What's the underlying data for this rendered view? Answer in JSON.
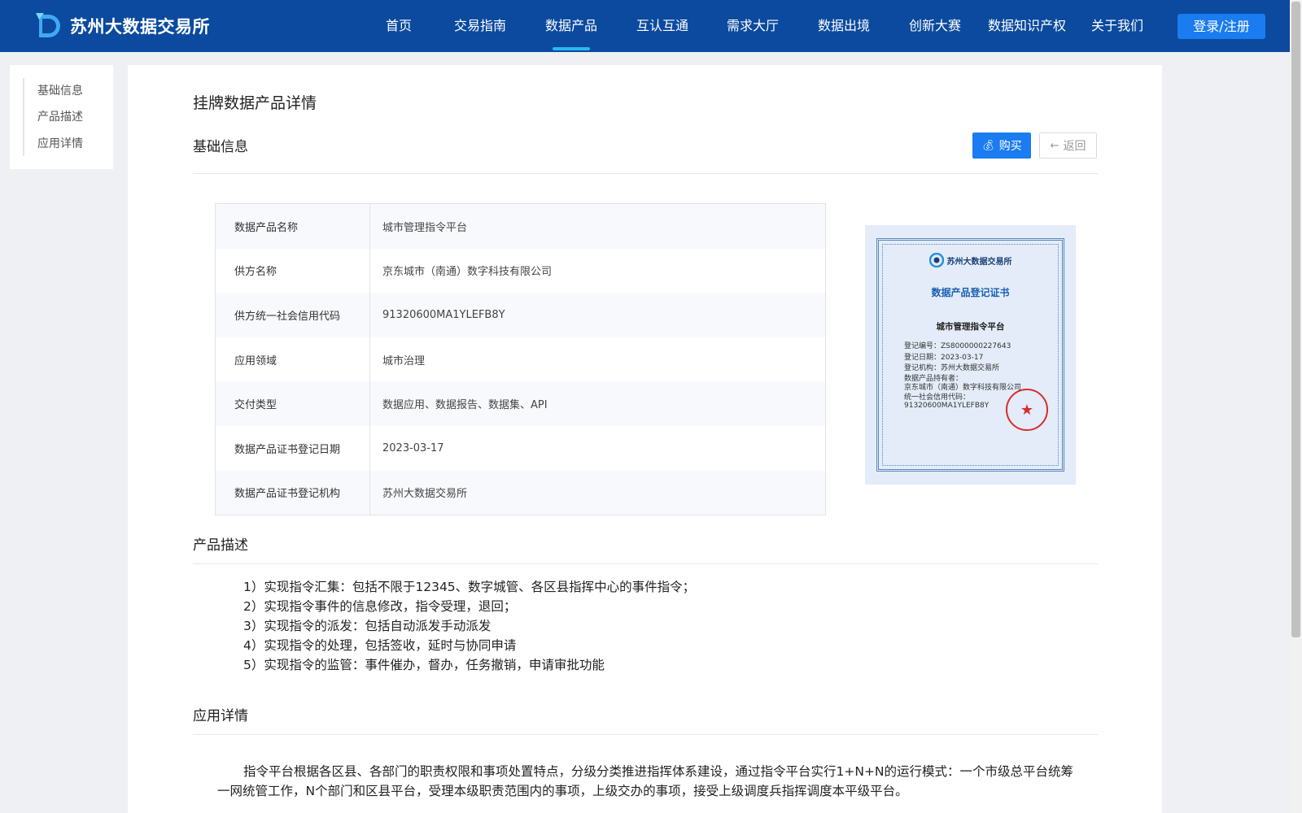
{
  "header": {
    "logo_text": "苏州大数据交易所",
    "nav": [
      {
        "label": "首页",
        "active": false
      },
      {
        "label": "交易指南",
        "active": false
      },
      {
        "label": "数据产品",
        "active": true
      },
      {
        "label": "互认互通",
        "active": false
      },
      {
        "label": "需求大厅",
        "active": false
      },
      {
        "label": "数据出境",
        "active": false
      },
      {
        "label": "创新大赛",
        "active": false
      },
      {
        "label": "数据知识产权",
        "active": false
      },
      {
        "label": "关于我们",
        "active": false
      }
    ],
    "login_label": "登录/注册"
  },
  "side_anchor": [
    "基础信息",
    "产品描述",
    "应用详情"
  ],
  "page_title": "挂牌数据产品详情",
  "sections": {
    "basic": "基础信息",
    "description": "产品描述",
    "detail": "应用详情"
  },
  "buttons": {
    "buy": "购买",
    "back": "返回"
  },
  "info_rows": [
    {
      "label": "数据产品名称",
      "value": "城市管理指令平台"
    },
    {
      "label": "供方名称",
      "value": "京东城市（南通）数字科技有限公司"
    },
    {
      "label": "供方统一社会信用代码",
      "value": "91320600MA1YLEFB8Y"
    },
    {
      "label": "应用领域",
      "value": "城市治理"
    },
    {
      "label": "交付类型",
      "value": "数据应用、数据报告、数据集、API"
    },
    {
      "label": "数据产品证书登记日期",
      "value": "2023-03-17"
    },
    {
      "label": "数据产品证书登记机构",
      "value": "苏州大数据交易所"
    }
  ],
  "certificate": {
    "org_name": "苏州大数据交易所",
    "title": "数据产品登记证书",
    "product_name": "城市管理指令平台",
    "lines": [
      "登记编号：ZS8000000227643",
      "登记日期：2023-03-17",
      "登记机构：苏州大数据交易所",
      "数据产品持有者：",
      "京东城市（南通）数字科技有限公司",
      "统一社会信用代码：",
      "91320600MA1YLEFB8Y"
    ]
  },
  "description_items": [
    "1）实现指令汇集：包括不限于12345、数字城管、各区县指挥中心的事件指令；",
    "2）实现指令事件的信息修改，指令受理，退回；",
    "3）实现指令的派发：包括自动派发手动派发",
    "4）实现指令的处理，包括签收，延时与协同申请",
    "5）实现指令的监管：事件催办，督办，任务撤销，申请审批功能"
  ],
  "detail_text": "指令平台根据各区县、各部门的职责权限和事项处置特点，分级分类推进指挥体系建设，通过指令平台实行1+N+N的运行模式：一个市级总平台统筹一网统管工作，N个部门和区县平台，受理本级职责范围内的事项，上级交办的事项，接受上级调度兵指挥调度本平级平台。"
}
